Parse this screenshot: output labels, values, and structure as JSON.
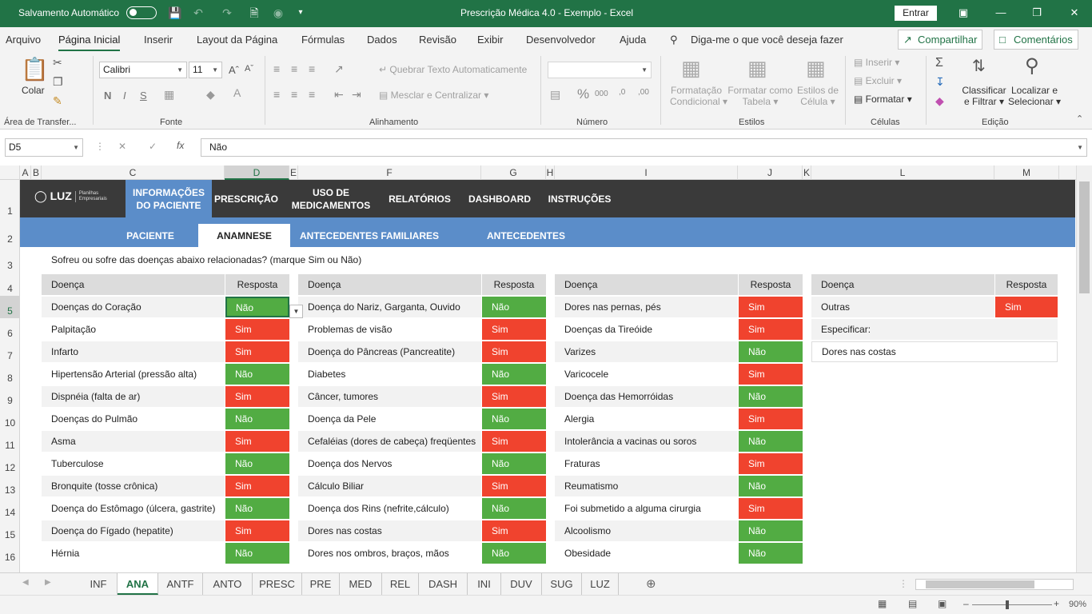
{
  "titlebar": {
    "autosave_label": "Salvamento Automático",
    "title": "Prescrição Médica 4.0 - Exemplo  -  Excel",
    "signin": "Entrar"
  },
  "menu": {
    "items": [
      "Arquivo",
      "Página Inicial",
      "Inserir",
      "Layout da Página",
      "Fórmulas",
      "Dados",
      "Revisão",
      "Exibir",
      "Desenvolvedor",
      "Ajuda"
    ],
    "search": "Diga-me o que você deseja fazer",
    "share": "Compartilhar",
    "comments": "Comentários"
  },
  "ribbon": {
    "paste": "Colar",
    "clipboard": "Área de Transfer...",
    "font_name": "Calibri",
    "font_size": "11",
    "font_group": "Fonte",
    "bold": "N",
    "italic": "I",
    "underline": "S",
    "wrap": "Quebrar Texto Automaticamente",
    "merge": "Mesclar e Centralizar",
    "align_group": "Alinhamento",
    "number_group": "Número",
    "cond_format": [
      "Formatação",
      "Condicional"
    ],
    "format_table": [
      "Formatar como",
      "Tabela"
    ],
    "cell_styles": [
      "Estilos de",
      "Célula"
    ],
    "styles_group": "Estilos",
    "insert": "Inserir",
    "delete": "Excluir",
    "format": "Formatar",
    "cells_group": "Células",
    "sort": [
      "Classificar",
      "e Filtrar"
    ],
    "find": [
      "Localizar e",
      "Selecionar"
    ],
    "edit_group": "Edição"
  },
  "formula": {
    "namebox": "D5",
    "fx": "fx",
    "value": "Não"
  },
  "columns": [
    "A",
    "B",
    "C",
    "D",
    "E",
    "F",
    "G",
    "H",
    "I",
    "J",
    "K",
    "L",
    "M"
  ],
  "rows": [
    "1",
    "2",
    "3",
    "4",
    "5",
    "6",
    "7",
    "8",
    "9",
    "10",
    "11",
    "12",
    "13",
    "14",
    "15",
    "16"
  ],
  "nav": {
    "logo": "LUZ",
    "logo_sub": "Planilhas Empresariais",
    "items": [
      "INFORMAÇÕES DO PACIENTE",
      "PRESCRIÇÃO",
      "USO DE MEDICAMENTOS",
      "RELATÓRIOS",
      "DASHBOARD",
      "INSTRUÇÕES"
    ]
  },
  "subnav": [
    "PACIENTE",
    "ANAMNESE",
    "ANTECEDENTES FAMILIARES",
    "ANTECEDENTES OCUPACIONAIS"
  ],
  "question": "Sofreu ou sofre das doenças abaixo relacionadas? (marque Sim ou Não)",
  "headers": {
    "disease": "Doença",
    "answer": "Resposta"
  },
  "table1": [
    [
      "Doenças do Coração",
      "Não"
    ],
    [
      "Palpitação",
      "Sim"
    ],
    [
      "Infarto",
      "Sim"
    ],
    [
      "Hipertensão Arterial (pressão alta)",
      "Não"
    ],
    [
      "Dispnéia (falta de ar)",
      "Sim"
    ],
    [
      "Doenças do Pulmão",
      "Não"
    ],
    [
      "Asma",
      "Sim"
    ],
    [
      "Tuberculose",
      "Não"
    ],
    [
      "Bronquite (tosse crônica)",
      "Sim"
    ],
    [
      "Doença do Estômago (úlcera, gastrite)",
      "Não"
    ],
    [
      "Doença do Fígado (hepatite)",
      "Sim"
    ],
    [
      "Hérnia",
      "Não"
    ]
  ],
  "table2": [
    [
      "Doença do Nariz, Garganta, Ouvido",
      "Não"
    ],
    [
      "Problemas de visão",
      "Sim"
    ],
    [
      "Doença do Pâncreas (Pancreatite)",
      "Sim"
    ],
    [
      "Diabetes",
      "Não"
    ],
    [
      "Câncer, tumores",
      "Sim"
    ],
    [
      "Doença da Pele",
      "Não"
    ],
    [
      "Cefaléias  (dores de cabeça) freqüentes",
      "Sim"
    ],
    [
      "Doença dos Nervos",
      "Não"
    ],
    [
      "Cálculo Biliar",
      "Sim"
    ],
    [
      "Doença dos Rins (nefrite,cálculo)",
      "Não"
    ],
    [
      "Dores nas costas",
      "Sim"
    ],
    [
      "Dores nos ombros, braços, mãos",
      "Não"
    ]
  ],
  "table3": [
    [
      "Dores nas pernas, pés",
      "Sim"
    ],
    [
      "Doenças da Tireóide",
      "Sim"
    ],
    [
      "Varizes",
      "Não"
    ],
    [
      "Varicocele",
      "Sim"
    ],
    [
      "Doença das Hemorróidas",
      "Não"
    ],
    [
      "Alergia",
      "Sim"
    ],
    [
      "Intolerância a vacinas ou soros",
      "Não"
    ],
    [
      "Fraturas",
      "Sim"
    ],
    [
      "Reumatismo",
      "Não"
    ],
    [
      "Foi submetido a alguma cirurgia",
      "Sim"
    ],
    [
      "Alcoolismo",
      "Não"
    ],
    [
      "Obesidade",
      "Não"
    ]
  ],
  "table4": {
    "other": "Outras",
    "other_answer": "Sim",
    "specify": "Especificar:",
    "specify_value": "Dores nas costas"
  },
  "tabs": [
    "INF",
    "ANA",
    "ANTF",
    "ANTO",
    "PRESC",
    "PRE",
    "MED",
    "REL",
    "DASH",
    "INI",
    "DUV",
    "SUG",
    "LUZ"
  ],
  "status": {
    "zoom": "90%"
  },
  "colors": {
    "excel_green": "#217346",
    "yes": "#f0432e",
    "no": "#52ac43",
    "nav_blue": "#5b8dc9"
  }
}
